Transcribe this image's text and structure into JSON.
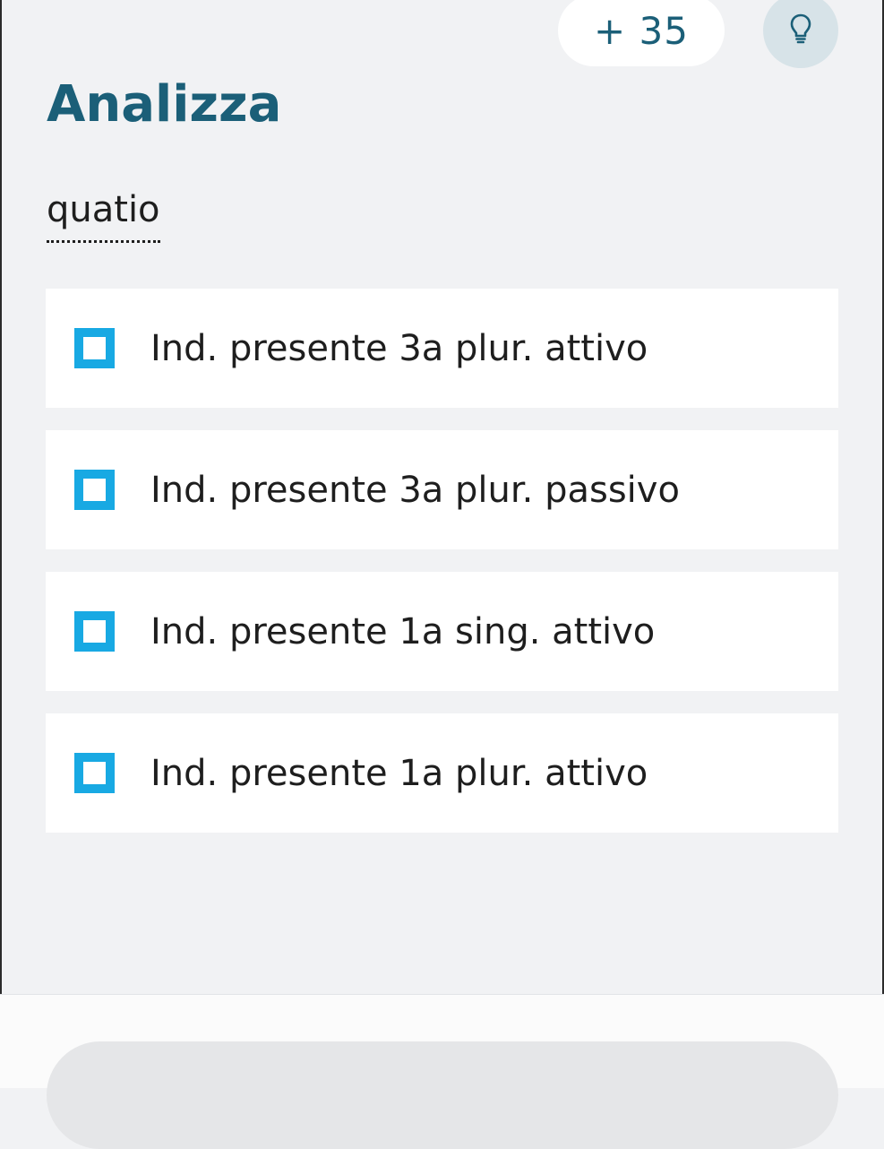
{
  "header": {
    "points": "+ 35",
    "hint_icon": "lightbulb-icon"
  },
  "exercise": {
    "title": "Analizza",
    "word": "quatio"
  },
  "options": [
    {
      "label": "Ind. presente 3a plur. attivo",
      "checked": false
    },
    {
      "label": "Ind. presente 3a plur. passivo",
      "checked": false
    },
    {
      "label": "Ind. presente 1a sing. attivo",
      "checked": false
    },
    {
      "label": "Ind. presente 1a plur. attivo",
      "checked": false
    }
  ],
  "colors": {
    "accent": "#1b5f78",
    "checkbox": "#18a9e3",
    "background": "#f1f2f4"
  }
}
